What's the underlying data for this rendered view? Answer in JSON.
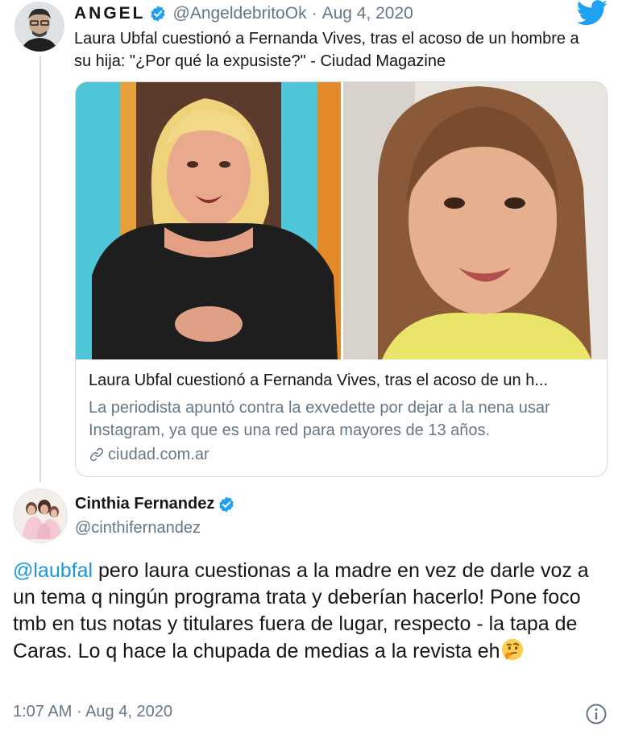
{
  "tweet1": {
    "author_name": "ANGEL",
    "verified": true,
    "handle": "@AngeldebritoOk",
    "separator": "·",
    "date": "Aug 4, 2020",
    "text": "Laura Ubfal cuestionó a Fernanda Vives, tras el acoso de un hombre a su hija: \"¿Por qué la expusiste?\" - Ciudad Magazine",
    "card": {
      "title": "Laura Ubfal cuestionó a Fernanda Vives, tras el acoso de un h...",
      "description": "La periodista apuntó contra la exvedette por dejar a la nena usar Instagram, ya que es una red para mayores de 13 años.",
      "domain": "ciudad.com.ar",
      "link_icon": "link-icon"
    }
  },
  "tweet2": {
    "author_name": "Cinthia Fernandez",
    "verified": true,
    "handle": "@cinthifernandez",
    "mention": "@laubfal",
    "text": " pero laura cuestionas a la madre en vez de darle voz a un tema q ningún programa trata y deberían hacerlo! Pone foco tmb en tus notas y titulares fuera de lugar, respecto - la tapa de Caras. Lo q hace la chupada de medias a la revista eh",
    "emoji": "thinking-face",
    "time": "1:07 AM",
    "separator": "·",
    "date": "Aug 4, 2020"
  },
  "colors": {
    "link": "#1b95e0",
    "secondary_text": "#657786",
    "verified": "#1da1f2",
    "border": "#cfd9de"
  },
  "icons": [
    "twitter-bird-icon",
    "verified-badge-icon",
    "link-icon",
    "info-icon",
    "thinking-face-emoji"
  ]
}
